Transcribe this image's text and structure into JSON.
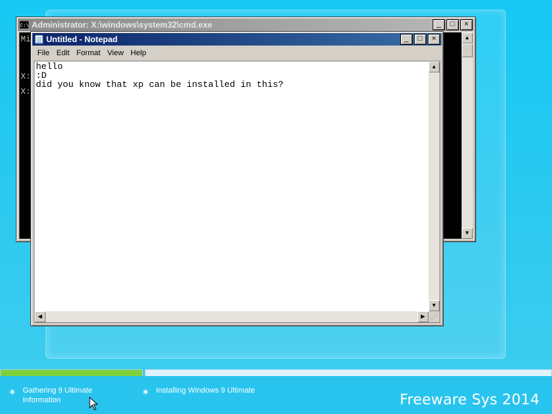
{
  "cmd_window": {
    "title": "Administrator: X:\\windows\\system32\\cmd.exe",
    "lines": [
      "Mi",
      "X:",
      "X:"
    ],
    "buttons": {
      "minimize": "_",
      "maximize": "□",
      "close": "×"
    }
  },
  "notepad": {
    "title": "Untitled - Notepad",
    "menu": [
      "File",
      "Edit",
      "Format",
      "View",
      "Help"
    ],
    "text": "hello\n:D\ndid you know that xp can be installed in this?",
    "buttons": {
      "minimize": "_",
      "maximize": "□",
      "close": "×"
    }
  },
  "installer": {
    "steps": [
      {
        "label": "Gathering 9 Ultimate Information",
        "progress": 1.0
      },
      {
        "label": "Installing Windows 9 Ultimate",
        "progress": 0.0
      }
    ],
    "brand": "Freeware Sys 2014"
  },
  "colors": {
    "desktop": "#29c4ee",
    "progress_green": "#7fcf3a",
    "notepad_title": "#0a246a"
  }
}
